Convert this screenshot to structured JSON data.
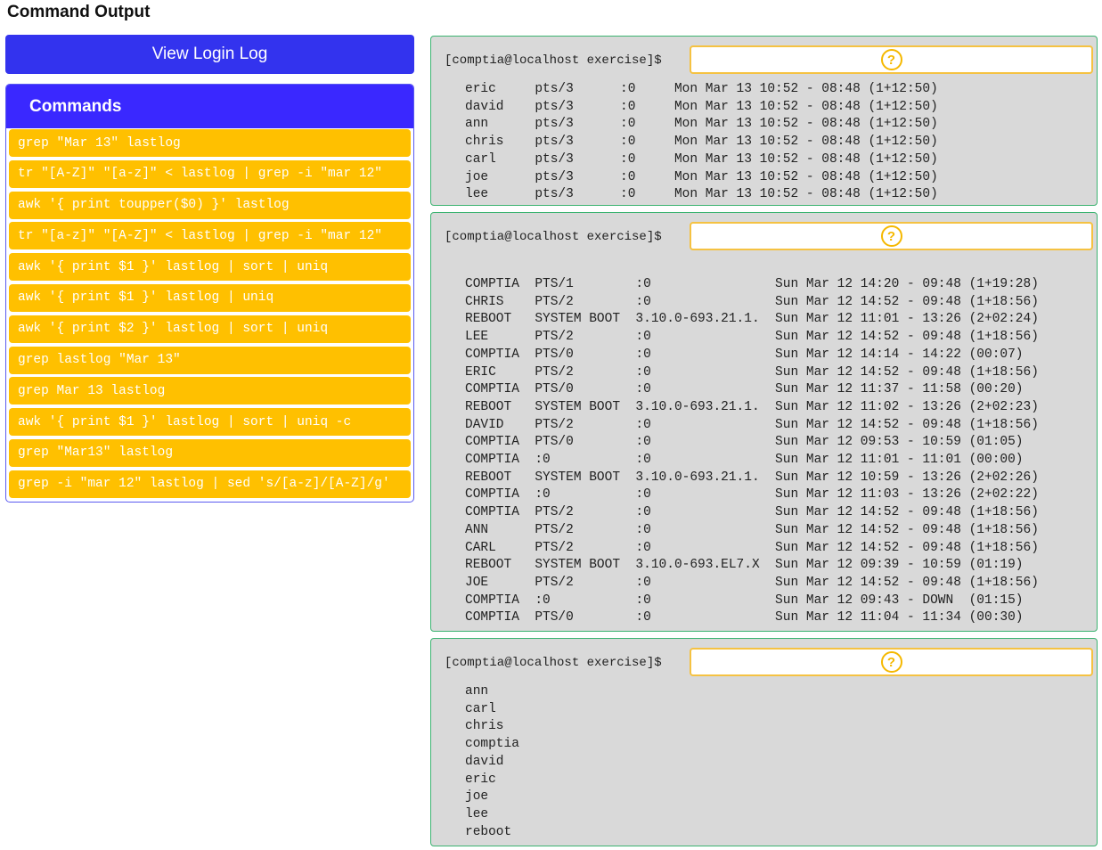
{
  "page": {
    "title": "Command Output"
  },
  "login_button": {
    "label": "View Login Log"
  },
  "commands": {
    "header": "Commands",
    "items": [
      "grep \"Mar 13\" lastlog",
      "tr \"[A-Z]\" \"[a-z]\" < lastlog | grep -i \"mar 12\"",
      "awk '{ print toupper($0) }' lastlog",
      "tr \"[a-z]\" \"[A-Z]\" < lastlog | grep -i \"mar 12\"",
      "awk '{ print $1 }' lastlog | sort | uniq",
      "awk '{ print $1 }' lastlog | uniq",
      "awk '{ print $2 }' lastlog | sort | uniq",
      "grep lastlog \"Mar 13\"",
      "grep Mar 13 lastlog",
      "awk '{ print $1 }' lastlog | sort | uniq -c",
      "grep \"Mar13\" lastlog",
      "grep -i \"mar 12\" lastlog | sed 's/[a-z]/[A-Z]/g'"
    ]
  },
  "terminals": [
    {
      "prompt": "[comptia@localhost exercise]$",
      "dropzone_icon": "question-icon",
      "output": "eric     pts/3      :0     Mon Mar 13 10:52 - 08:48 (1+12:50)\ndavid    pts/3      :0     Mon Mar 13 10:52 - 08:48 (1+12:50)\nann      pts/3      :0     Mon Mar 13 10:52 - 08:48 (1+12:50)\nchris    pts/3      :0     Mon Mar 13 10:52 - 08:48 (1+12:50)\ncarl     pts/3      :0     Mon Mar 13 10:52 - 08:48 (1+12:50)\njoe      pts/3      :0     Mon Mar 13 10:52 - 08:48 (1+12:50)\nlee      pts/3      :0     Mon Mar 13 10:52 - 08:48 (1+12:50)"
    },
    {
      "prompt": "[comptia@localhost exercise]$",
      "dropzone_icon": "question-icon",
      "output": "COMPTIA  PTS/1        :0                Sun Mar 12 14:20 - 09:48 (1+19:28)\nCHRIS    PTS/2        :0                Sun Mar 12 14:52 - 09:48 (1+18:56)\nREBOOT   SYSTEM BOOT  3.10.0-693.21.1.  Sun Mar 12 11:01 - 13:26 (2+02:24)\nLEE      PTS/2        :0                Sun Mar 12 14:52 - 09:48 (1+18:56)\nCOMPTIA  PTS/0        :0                Sun Mar 12 14:14 - 14:22 (00:07)\nERIC     PTS/2        :0                Sun Mar 12 14:52 - 09:48 (1+18:56)\nCOMPTIA  PTS/0        :0                Sun Mar 12 11:37 - 11:58 (00:20)\nREBOOT   SYSTEM BOOT  3.10.0-693.21.1.  Sun Mar 12 11:02 - 13:26 (2+02:23)\nDAVID    PTS/2        :0                Sun Mar 12 14:52 - 09:48 (1+18:56)\nCOMPTIA  PTS/0        :0                Sun Mar 12 09:53 - 10:59 (01:05)\nCOMPTIA  :0           :0                Sun Mar 12 11:01 - 11:01 (00:00)\nREBOOT   SYSTEM BOOT  3.10.0-693.21.1.  Sun Mar 12 10:59 - 13:26 (2+02:26)\nCOMPTIA  :0           :0                Sun Mar 12 11:03 - 13:26 (2+02:22)\nCOMPTIA  PTS/2        :0                Sun Mar 12 14:52 - 09:48 (1+18:56)\nANN      PTS/2        :0                Sun Mar 12 14:52 - 09:48 (1+18:56)\nCARL     PTS/2        :0                Sun Mar 12 14:52 - 09:48 (1+18:56)\nREBOOT   SYSTEM BOOT  3.10.0-693.EL7.X  Sun Mar 12 09:39 - 10:59 (01:19)\nJOE      PTS/2        :0                Sun Mar 12 14:52 - 09:48 (1+18:56)\nCOMPTIA  :0           :0                Sun Mar 12 09:43 - DOWN  (01:15)\nCOMPTIA  PTS/0        :0                Sun Mar 12 11:04 - 11:34 (00:30)"
    },
    {
      "prompt": "[comptia@localhost exercise]$",
      "dropzone_icon": "question-icon",
      "output": "ann\ncarl\nchris\ncomptia\ndavid\neric\njoe\nlee\nreboot"
    }
  ]
}
